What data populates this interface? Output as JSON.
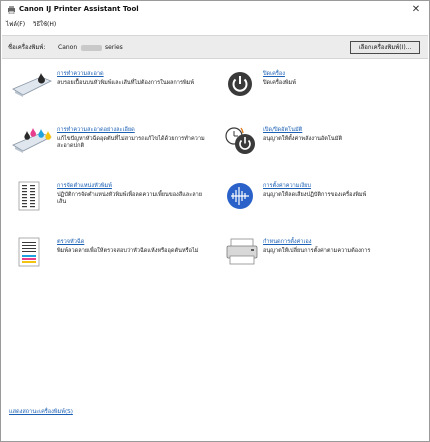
{
  "window": {
    "title": "Canon IJ Printer Assistant Tool",
    "close_icon": "close-icon"
  },
  "menu": {
    "items": [
      "ไฟล์(F)",
      "วิธีใช้(H)"
    ]
  },
  "printer_bar": {
    "label": "ชื่อเครื่องพิมพ์:",
    "model_prefix": "Canon",
    "model_suffix": "series",
    "select_button": "เลือกเครื่องพิมพ์(I)..."
  },
  "features": [
    {
      "icon": "nozzle-cleaning-icon",
      "title": "การทำความสะอาด",
      "desc": "ลบรอยเปื้อนบนหัวพิมพ์และเส้นที่ไม่ต้องการในผลการพิมพ์"
    },
    {
      "icon": "power-off-icon",
      "title": "ปิดเครื่อง",
      "desc": "ปิดเครื่องพิมพ์"
    },
    {
      "icon": "deep-cleaning-icon",
      "title": "การทำความสะอาดอย่างละเอียด",
      "desc": "แก้ไขปัญหาหัวฉีดอุดตันที่ไม่สามารถแก้ไขได้ด้วยการทำความสะอาดปกติ"
    },
    {
      "icon": "auto-power-icon",
      "title": "เปิด/ปิดอัตโนมัติ",
      "desc": "อนุญาตให้ตั้งค่าพลังงานอัตโนมัติ"
    },
    {
      "icon": "print-head-alignment-icon",
      "title": "การจัดตำแหน่งหัวพิมพ์",
      "desc": "ปฏิบัติการจัดตำแหน่งหัวพิมพ์เพื่อลดความเพี้ยนของสีและลายเส้น"
    },
    {
      "icon": "quiet-settings-icon",
      "title": "การตั้งค่าความเงียบ",
      "desc": "อนุญาตให้ลดเสียงปฏิบัติการของเครื่องพิมพ์"
    },
    {
      "icon": "nozzle-check-icon",
      "title": "ตรวจหัวฉีด",
      "desc": "พิมพ์ลวดลายเพื่อให้ตรวจสอบว่าหัวฉีดแห้งหรืออุดตันหรือไม่"
    },
    {
      "icon": "custom-settings-icon",
      "title": "กำหนดการตั้งค่าเอง",
      "desc": "อนุญาตให้เปลี่ยนการตั้งค่าตามความต้องการ"
    }
  ],
  "status_link": "แสดงสถานะเครื่องพิมพ์(S)",
  "colors": {
    "link": "#1a5fb4",
    "bar": "#ececec",
    "accent_blue": "#2a62c9",
    "icon_dark": "#3a3a3a"
  }
}
